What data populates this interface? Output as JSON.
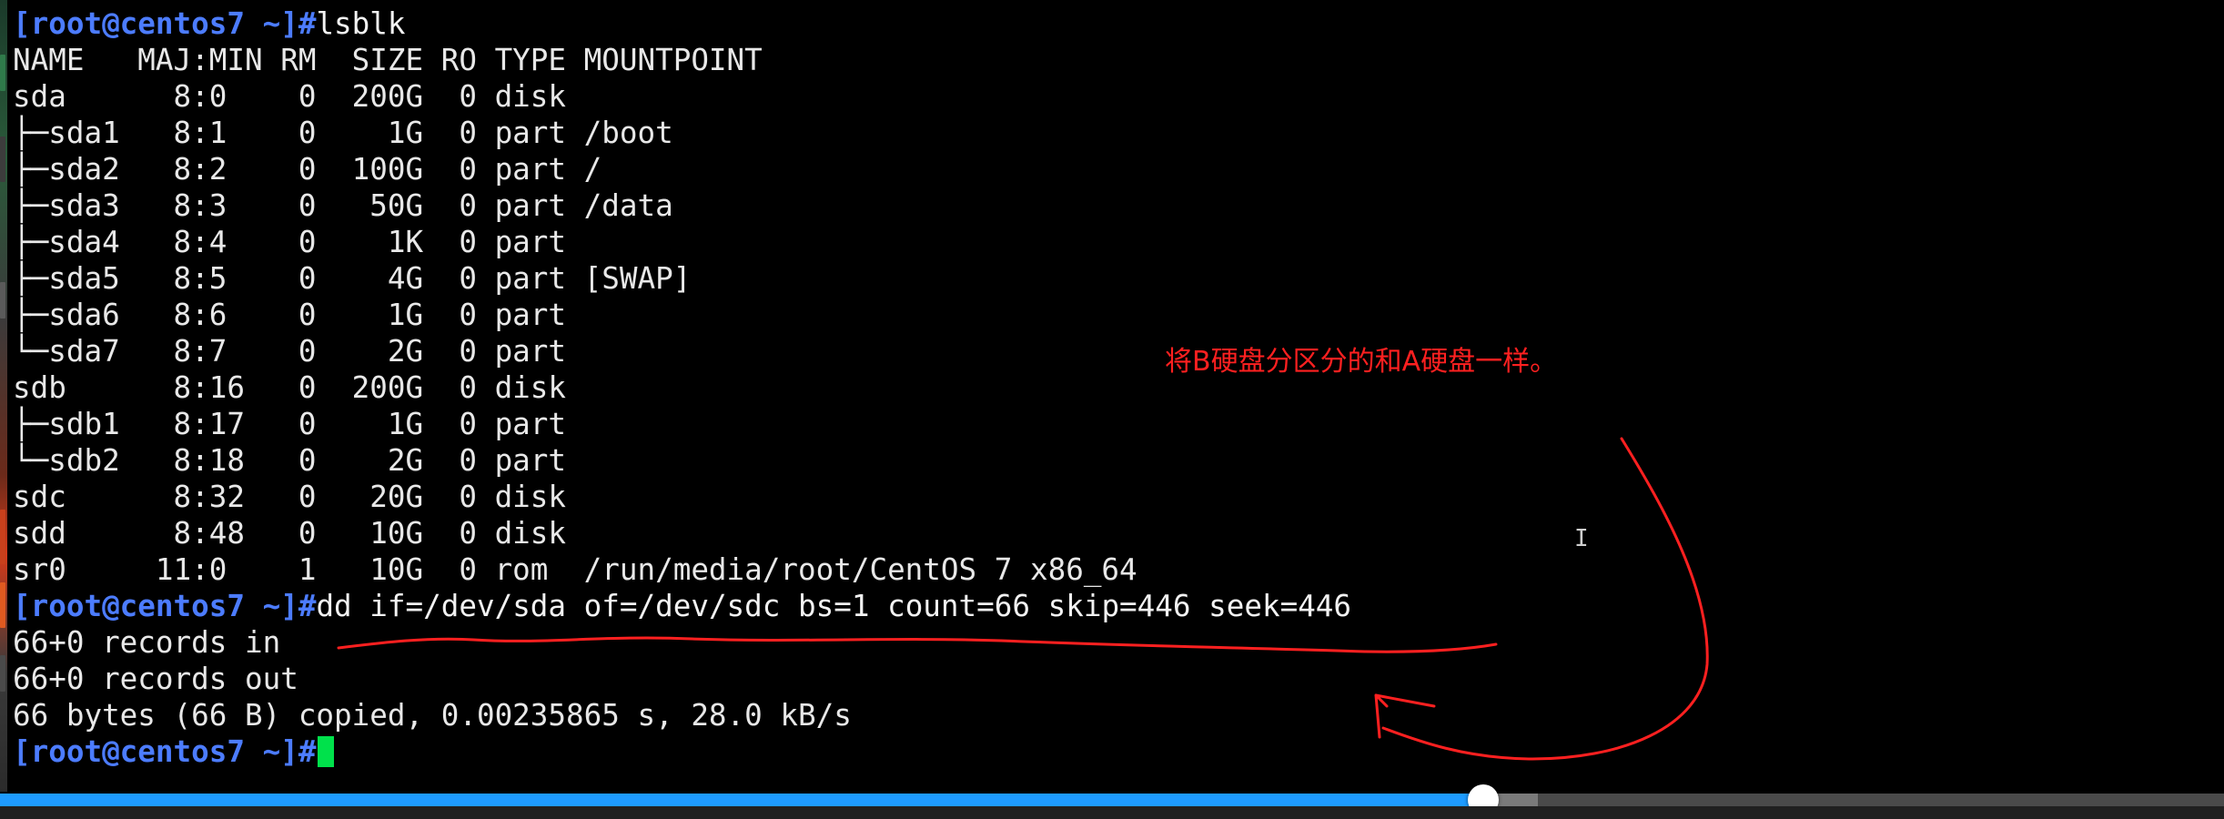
{
  "terminal": {
    "prompt": "[root@centos7 ~]#",
    "lines": [
      {
        "kind": "prompt",
        "cmd": "lsblk"
      },
      {
        "kind": "out",
        "text": "NAME   MAJ:MIN RM  SIZE RO TYPE MOUNTPOINT"
      },
      {
        "kind": "out",
        "text": "sda      8:0    0  200G  0 disk "
      },
      {
        "kind": "out",
        "text": "├─sda1   8:1    0    1G  0 part /boot"
      },
      {
        "kind": "out",
        "text": "├─sda2   8:2    0  100G  0 part /"
      },
      {
        "kind": "out",
        "text": "├─sda3   8:3    0   50G  0 part /data"
      },
      {
        "kind": "out",
        "text": "├─sda4   8:4    0    1K  0 part "
      },
      {
        "kind": "out",
        "text": "├─sda5   8:5    0    4G  0 part [SWAP]"
      },
      {
        "kind": "out",
        "text": "├─sda6   8:6    0    1G  0 part "
      },
      {
        "kind": "out",
        "text": "└─sda7   8:7    0    2G  0 part "
      },
      {
        "kind": "out",
        "text": "sdb      8:16   0  200G  0 disk "
      },
      {
        "kind": "out",
        "text": "├─sdb1   8:17   0    1G  0 part "
      },
      {
        "kind": "out",
        "text": "└─sdb2   8:18   0    2G  0 part "
      },
      {
        "kind": "out",
        "text": "sdc      8:32   0   20G  0 disk "
      },
      {
        "kind": "out",
        "text": "sdd      8:48   0   10G  0 disk "
      },
      {
        "kind": "out",
        "text": "sr0     11:0    1   10G  0 rom  /run/media/root/CentOS 7 x86_64"
      },
      {
        "kind": "prompt",
        "cmd": "dd if=/dev/sda of=/dev/sdc bs=1 count=66 skip=446 seek=446"
      },
      {
        "kind": "out",
        "text": "66+0 records in"
      },
      {
        "kind": "out",
        "text": "66+0 records out"
      },
      {
        "kind": "out",
        "text": "66 bytes (66 B) copied, 0.00235865 s, 28.0 kB/s"
      },
      {
        "kind": "prompt",
        "cmd": "",
        "cursor": true
      }
    ]
  },
  "annotation": {
    "text": "将B硬盘分区分的和A硬盘一样。",
    "color": "#ff2020"
  },
  "player": {
    "progress_fraction": 0.667,
    "fill_color": "#1e9bff"
  },
  "colors": {
    "background": "#000000",
    "prompt": "#4c7cff",
    "output": "#e8e8e8",
    "cursor": "#00e14b"
  }
}
